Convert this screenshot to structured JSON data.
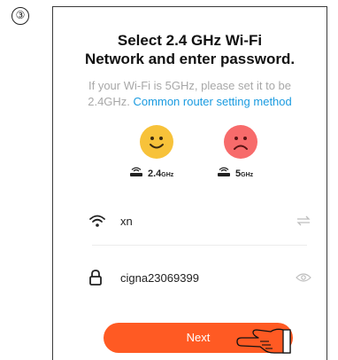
{
  "step": {
    "number": "③"
  },
  "header": {
    "title_line1": "Select 2.4 GHz Wi-Fi",
    "title_line2": "Network and enter password."
  },
  "instructions": {
    "text_line1": "If your Wi-Fi is 5GHz, please set it to be",
    "text_prefix": "2.4GHz.",
    "link_text": "Common router setting method"
  },
  "bands": {
    "supported": {
      "value": "2.4",
      "unit": "GHz",
      "face_icon": "happy-face-icon"
    },
    "unsupported": {
      "value": "5",
      "unit": "GHz",
      "face_icon": "sad-face-icon"
    }
  },
  "wifi_field": {
    "value": "xn",
    "lead_icon": "wifi-icon",
    "trail_icon": "switch-network-icon"
  },
  "password_field": {
    "value": "cigna23069399",
    "lead_icon": "lock-icon",
    "trail_icon": "eye-icon"
  },
  "actions": {
    "next_label": "Next"
  },
  "colors": {
    "accent": "#ff5a23",
    "link": "#1a9be0",
    "happy": "#f7c23a",
    "sad": "#f76b6b"
  }
}
